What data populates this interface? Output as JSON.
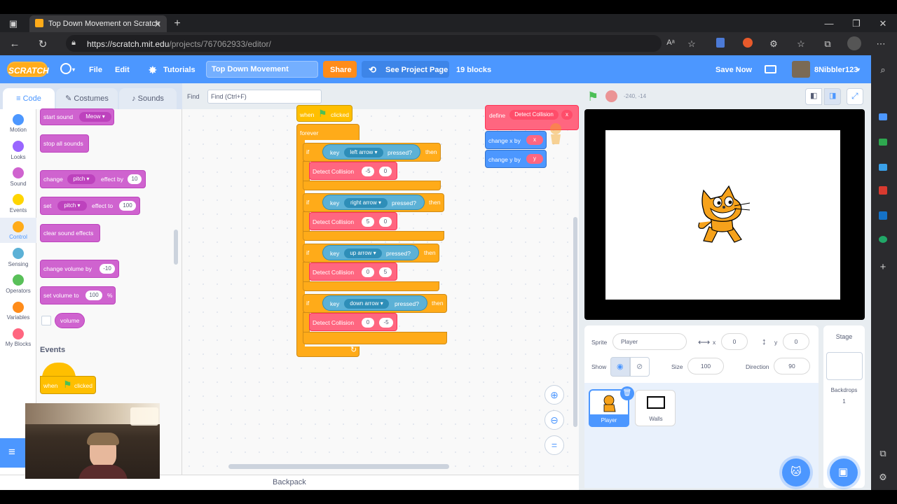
{
  "browser": {
    "tab_title": "Top Down Movement on Scratch",
    "url_host": "https://scratch.mit.edu",
    "url_path": "/projects/767062933/editor/"
  },
  "menubar": {
    "logo": "SCRATCH",
    "file": "File",
    "edit": "Edit",
    "tutorials": "Tutorials",
    "project_title": "Top Down Movement",
    "share": "Share",
    "see_project_page": "See Project Page",
    "block_count": "19 blocks",
    "save_now": "Save Now",
    "username": "8Nibbler123"
  },
  "editor_tabs": {
    "code": "Code",
    "costumes": "Costumes",
    "sounds": "Sounds"
  },
  "find": {
    "label": "Find",
    "placeholder": "Find (Ctrl+F)"
  },
  "categories": [
    {
      "label": "Motion",
      "color": "#4c97ff"
    },
    {
      "label": "Looks",
      "color": "#9966ff"
    },
    {
      "label": "Sound",
      "color": "#cf63cf"
    },
    {
      "label": "Events",
      "color": "#ffd500"
    },
    {
      "label": "Control",
      "color": "#ffab19"
    },
    {
      "label": "Sensing",
      "color": "#5cb1d6"
    },
    {
      "label": "Operators",
      "color": "#59c059"
    },
    {
      "label": "Variables",
      "color": "#ff8c1a"
    },
    {
      "label": "My Blocks",
      "color": "#ff6680"
    }
  ],
  "palette": {
    "start_sound": "start sound",
    "start_sound_value": "Meow",
    "stop_all_sounds": "stop all sounds",
    "change": "change",
    "pitch": "pitch",
    "effect_by": "effect by",
    "effect_by_value": "10",
    "set": "set",
    "effect_to": "effect to",
    "effect_to_value": "100",
    "clear_sound_effects": "clear sound effects",
    "change_volume_by": "change volume by",
    "change_volume_value": "-10",
    "set_volume_to": "set volume to",
    "set_volume_value": "100",
    "percent": "%",
    "volume": "volume",
    "events_heading": "Events",
    "when": "when",
    "clicked": "clicked"
  },
  "script": {
    "when": "when",
    "clicked": "clicked",
    "forever": "forever",
    "if_word": "if",
    "key": "key",
    "pressed": "pressed?",
    "then": "then",
    "detect": "Detect Collision",
    "ifs": [
      {
        "key": "left arrow",
        "a": "-5",
        "b": "0"
      },
      {
        "key": "right arrow",
        "a": "5",
        "b": "0"
      },
      {
        "key": "up arrow",
        "a": "0",
        "b": "5"
      },
      {
        "key": "down arrow",
        "a": "0",
        "b": "-5"
      }
    ]
  },
  "define_script": {
    "define": "define",
    "name": "Detect Collision",
    "param_x": "x",
    "param_y": "y",
    "change_x_by": "change x by",
    "change_y_by": "change y by"
  },
  "stage": {
    "coords": "-240, -14"
  },
  "sprite_info": {
    "sprite_label": "Sprite",
    "sprite_name": "Player",
    "x_label": "x",
    "x_value": "0",
    "y_label": "y",
    "y_value": "0",
    "show_label": "Show",
    "size_label": "Size",
    "size_value": "100",
    "direction_label": "Direction",
    "direction_value": "90"
  },
  "sprites": [
    {
      "name": "Player"
    },
    {
      "name": "Walls"
    }
  ],
  "stage_panel": {
    "title": "Stage",
    "backdrops_label": "Backdrops",
    "backdrops_count": "1"
  },
  "backpack": "Backpack"
}
